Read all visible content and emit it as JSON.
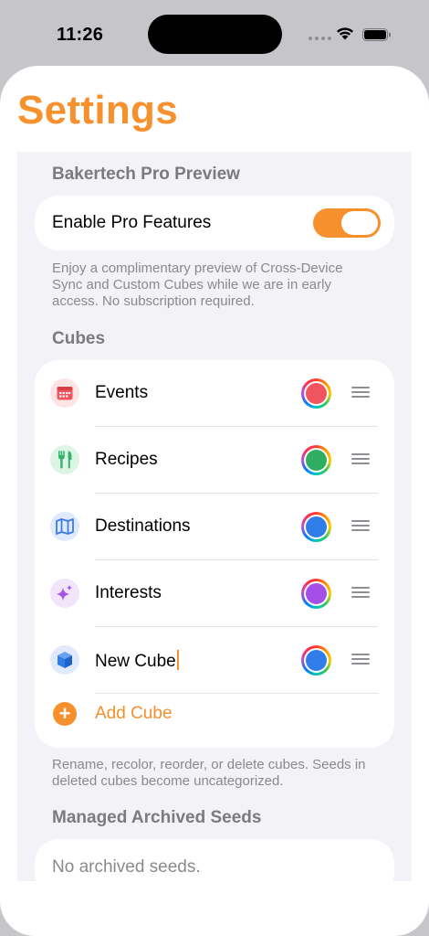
{
  "status_bar": {
    "time": "11:26"
  },
  "page": {
    "title": "Settings"
  },
  "pro_section": {
    "header": "Bakertech Pro Preview",
    "toggle_label": "Enable Pro Features",
    "toggle_on": true,
    "footer": "Enjoy a complimentary preview of Cross-Device Sync and Custom Cubes while we are in early access. No subscription required."
  },
  "cubes_section": {
    "header": "Cubes",
    "items": [
      {
        "label": "Events",
        "icon": "calendar-icon",
        "icon_color": "#f0555d",
        "icon_bg": "#fde5e6",
        "color": "#f0555d"
      },
      {
        "label": "Recipes",
        "icon": "fork-knife-icon",
        "icon_color": "#34b36a",
        "icon_bg": "#ddf4e6",
        "color": "#2fae62"
      },
      {
        "label": "Destinations",
        "icon": "map-icon",
        "icon_color": "#3b7be8",
        "icon_bg": "#e0eafc",
        "color": "#2f7de9"
      },
      {
        "label": "Interests",
        "icon": "sparkles-icon",
        "icon_color": "#a553e6",
        "icon_bg": "#f1e4fb",
        "color": "#a54fe8"
      },
      {
        "label": "New Cube",
        "icon": "cube-icon",
        "icon_color": "#2f7de9",
        "icon_bg": "#e0eafc",
        "color": "#2f7de9"
      }
    ],
    "add_label": "Add Cube",
    "footer": "Rename, recolor, reorder, or delete cubes. Seeds in deleted cubes become uncategorized."
  },
  "archived_section": {
    "header": "Managed Archived Seeds",
    "empty_text": "No archived seeds."
  },
  "colors": {
    "accent": "#f5902c",
    "secondary_text": "#8a8a8e",
    "grouped_bg": "#f2f2f7"
  }
}
